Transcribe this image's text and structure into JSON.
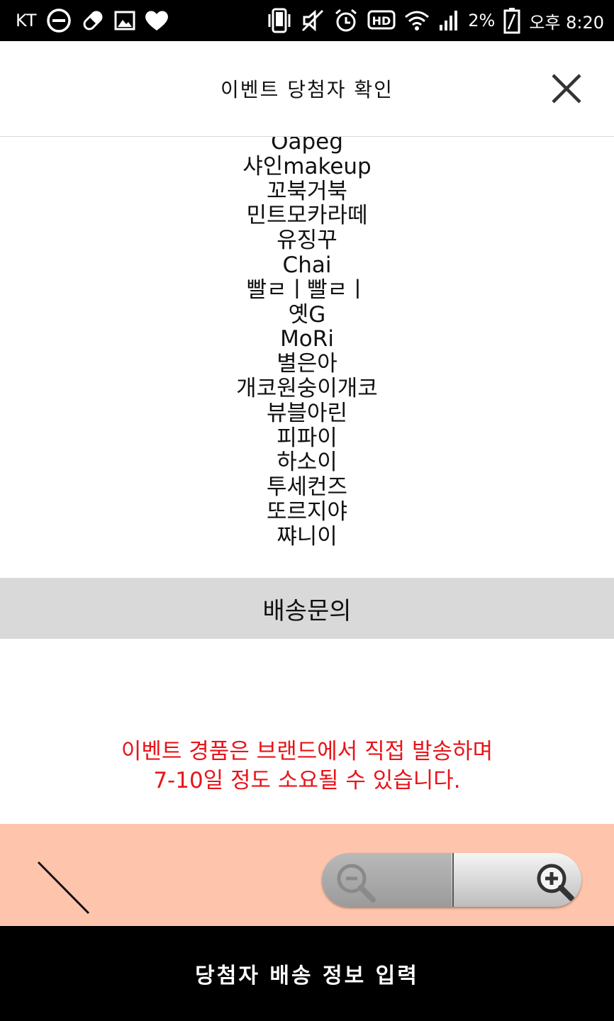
{
  "status_bar": {
    "carrier": "KT",
    "battery": "2%",
    "time": "오후 8:20",
    "icons": [
      "minus-circle-icon",
      "pill-icon",
      "image-icon",
      "heart-icon",
      "phone-vibrate-icon",
      "mute-icon",
      "alarm-icon",
      "hd-icon",
      "wifi-icon",
      "signal-icon",
      "battery-icon"
    ]
  },
  "header": {
    "title": "이벤트 당첨자 확인",
    "close_icon": "close-icon"
  },
  "winners": [
    "Oapeg",
    "샤인makeup",
    "꼬북거북",
    "민트모카라떼",
    "유징꾸",
    "Chai",
    "빨ㄹㅣ빨ㄹㅣ",
    "옛G",
    "MoRi",
    "별은아",
    "개코원숭이개코",
    "뷰블아린",
    "피파이",
    "하소이",
    "투세컨즈",
    "또르지야",
    "쨔니이"
  ],
  "inquiry_bar": {
    "label": "배송문의"
  },
  "notice": {
    "line1": "이벤트 경품은 브랜드에서 직접 발송하며",
    "line2": "7-10일 정도 소요될 수 있습니다.",
    "color": "#e8141a"
  },
  "zoom": {
    "out_icon": "zoom-out-icon",
    "in_icon": "zoom-in-icon"
  },
  "cta": {
    "label": "당첨자 배송 정보 입력"
  },
  "colors": {
    "salmon": "#ffc5ac",
    "bar_gray": "#d9d9d9"
  }
}
